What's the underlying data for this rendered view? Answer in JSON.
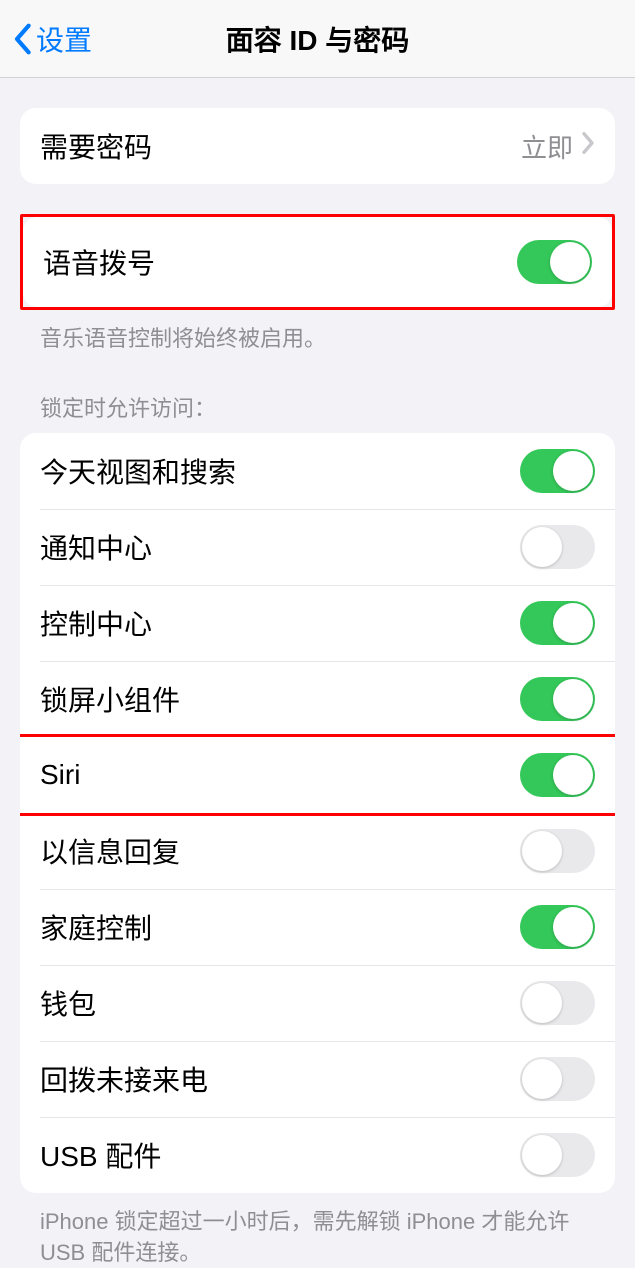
{
  "header": {
    "back_label": "设置",
    "title": "面容 ID 与密码"
  },
  "require_passcode": {
    "label": "需要密码",
    "value": "立即"
  },
  "voice_dial": {
    "label": "语音拨号",
    "on": true,
    "footer": "音乐语音控制将始终被启用。"
  },
  "lock_access": {
    "header": "锁定时允许访问：",
    "items": [
      {
        "label": "今天视图和搜索",
        "on": true
      },
      {
        "label": "通知中心",
        "on": false
      },
      {
        "label": "控制中心",
        "on": true
      },
      {
        "label": "锁屏小组件",
        "on": true
      },
      {
        "label": "Siri",
        "on": true
      },
      {
        "label": "以信息回复",
        "on": false
      },
      {
        "label": "家庭控制",
        "on": true
      },
      {
        "label": "钱包",
        "on": false
      },
      {
        "label": "回拨未接来电",
        "on": false
      },
      {
        "label": "USB 配件",
        "on": false
      }
    ],
    "footer": "iPhone 锁定超过一小时后，需先解锁 iPhone 才能允许USB 配件连接。"
  },
  "highlights": [
    "voice_dial",
    "siri"
  ]
}
